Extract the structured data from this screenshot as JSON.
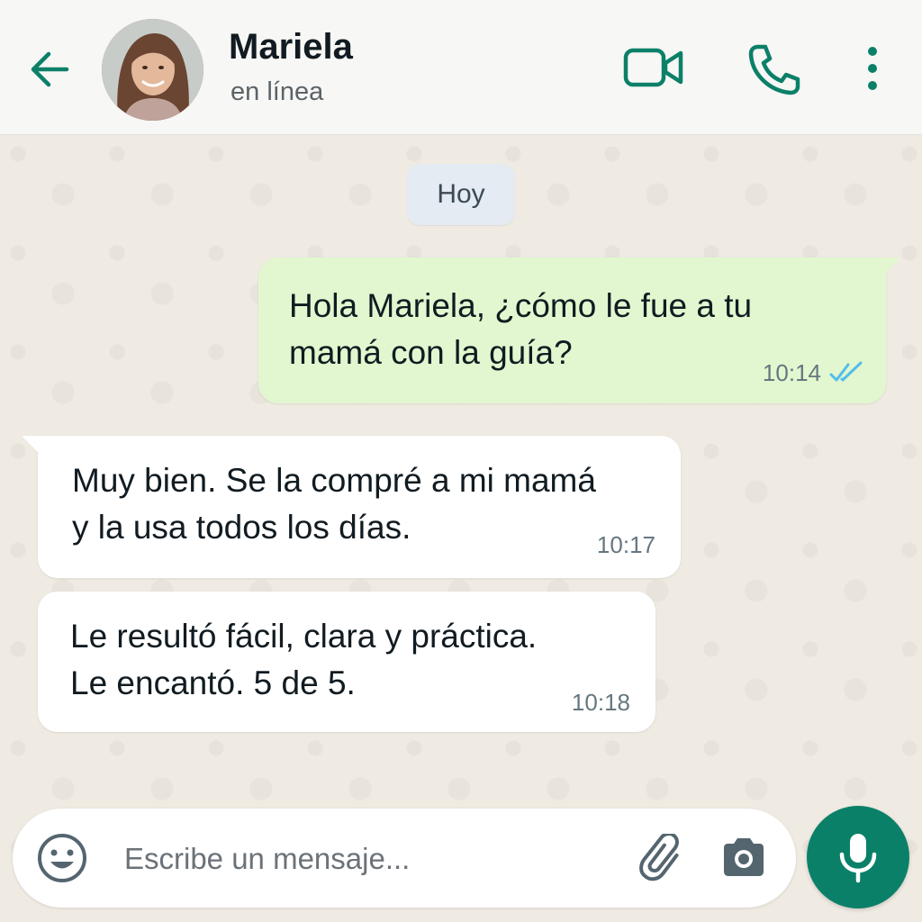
{
  "header": {
    "contact_name": "Mariela",
    "status": "en línea"
  },
  "chat": {
    "date_chip": "Hoy",
    "messages": [
      {
        "direction": "outgoing",
        "text": "Hola Mariela, ¿cómo le fue a tu\nmamá con la guía?",
        "time": "10:14",
        "status": "read"
      },
      {
        "direction": "incoming",
        "text": "Muy bien. Se la compré a mi mamá\ny la usa todos los días.",
        "time": "10:17"
      },
      {
        "direction": "incoming",
        "text": "Le resultó fácil, clara y práctica.\nLe encantó. 5 de 5.",
        "time": "10:18"
      }
    ]
  },
  "composer": {
    "placeholder": "Escribe un mensaje...",
    "value": ""
  },
  "icons": {
    "back": "arrow-left-icon",
    "video": "video-camera-icon",
    "call": "phone-icon",
    "menu": "more-vertical-icon",
    "emoji": "emoji-icon",
    "attach": "paperclip-icon",
    "camera": "camera-icon",
    "mic": "microphone-icon"
  },
  "colors": {
    "accent": "#0b8068",
    "outgoing_bubble": "#e2f7cf",
    "incoming_bubble": "#ffffff",
    "read_ticks": "#53bdeb",
    "chat_background": "#efeae2"
  }
}
